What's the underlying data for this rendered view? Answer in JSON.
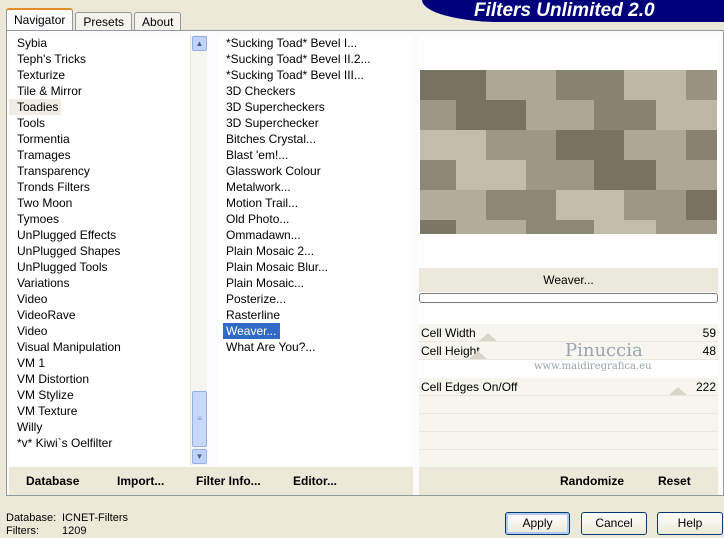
{
  "tabs": [
    "Navigator",
    "Presets",
    "About"
  ],
  "brand": "Filters Unlimited 2.0",
  "categories": [
    "Sybia",
    "Teph's Tricks",
    "Texturize",
    "Tile & Mirror",
    "Toadies",
    "Tools",
    "Tormentia",
    "Tramages",
    "Transparency",
    "Tronds Filters",
    "Two Moon",
    "Tymoes",
    "UnPlugged Effects",
    "UnPlugged Shapes",
    "UnPlugged Tools",
    "Variations",
    "Video",
    "VideoRave",
    "Video",
    "Visual Manipulation",
    "VM 1",
    "VM Distortion",
    "VM Stylize",
    "VM Texture",
    "Willy",
    "*v* Kiwi`s Oelfilter"
  ],
  "selected_category": "Toadies",
  "filters": [
    "*Sucking Toad*  Bevel I...",
    "*Sucking Toad*  Bevel II.2...",
    "*Sucking Toad*  Bevel III...",
    "3D Checkers",
    "3D Supercheckers",
    "3D Superchecker",
    "Bitches Crystal...",
    "Blast 'em!...",
    "Glasswork Colour",
    "Metalwork...",
    "Motion Trail...",
    "Old Photo...",
    "Ommadawn...",
    "Plain Mosaic 2...",
    "Plain Mosaic Blur...",
    "Plain Mosaic...",
    "Posterize...",
    "Rasterline",
    "Weaver...",
    "What Are You?..."
  ],
  "selected_filter": "Weaver...",
  "bottom_buttons": {
    "database": "Database",
    "import": "Import...",
    "filter_info": "Filter Info...",
    "editor": "Editor...",
    "randomize": "Randomize",
    "reset": "Reset"
  },
  "filter_name": "Weaver...",
  "params": [
    {
      "label": "Cell Width",
      "value": "59"
    },
    {
      "label": "Cell Height",
      "value": "48"
    },
    {
      "label": "Cell Edges On/Off",
      "value": "222"
    }
  ],
  "watermark": {
    "name": "Pinuccia",
    "site": "www.maidiregrafica.eu"
  },
  "status": {
    "db_label": "Database:",
    "db_value": "ICNET-Filters",
    "filters_label": "Filters:",
    "filters_value": "1209"
  },
  "actions": {
    "apply": "Apply",
    "cancel": "Cancel",
    "help": "Help"
  },
  "colors": {
    "accent": "#316ac5",
    "brand_bg": "#00007b",
    "window": "#ece9d8"
  }
}
